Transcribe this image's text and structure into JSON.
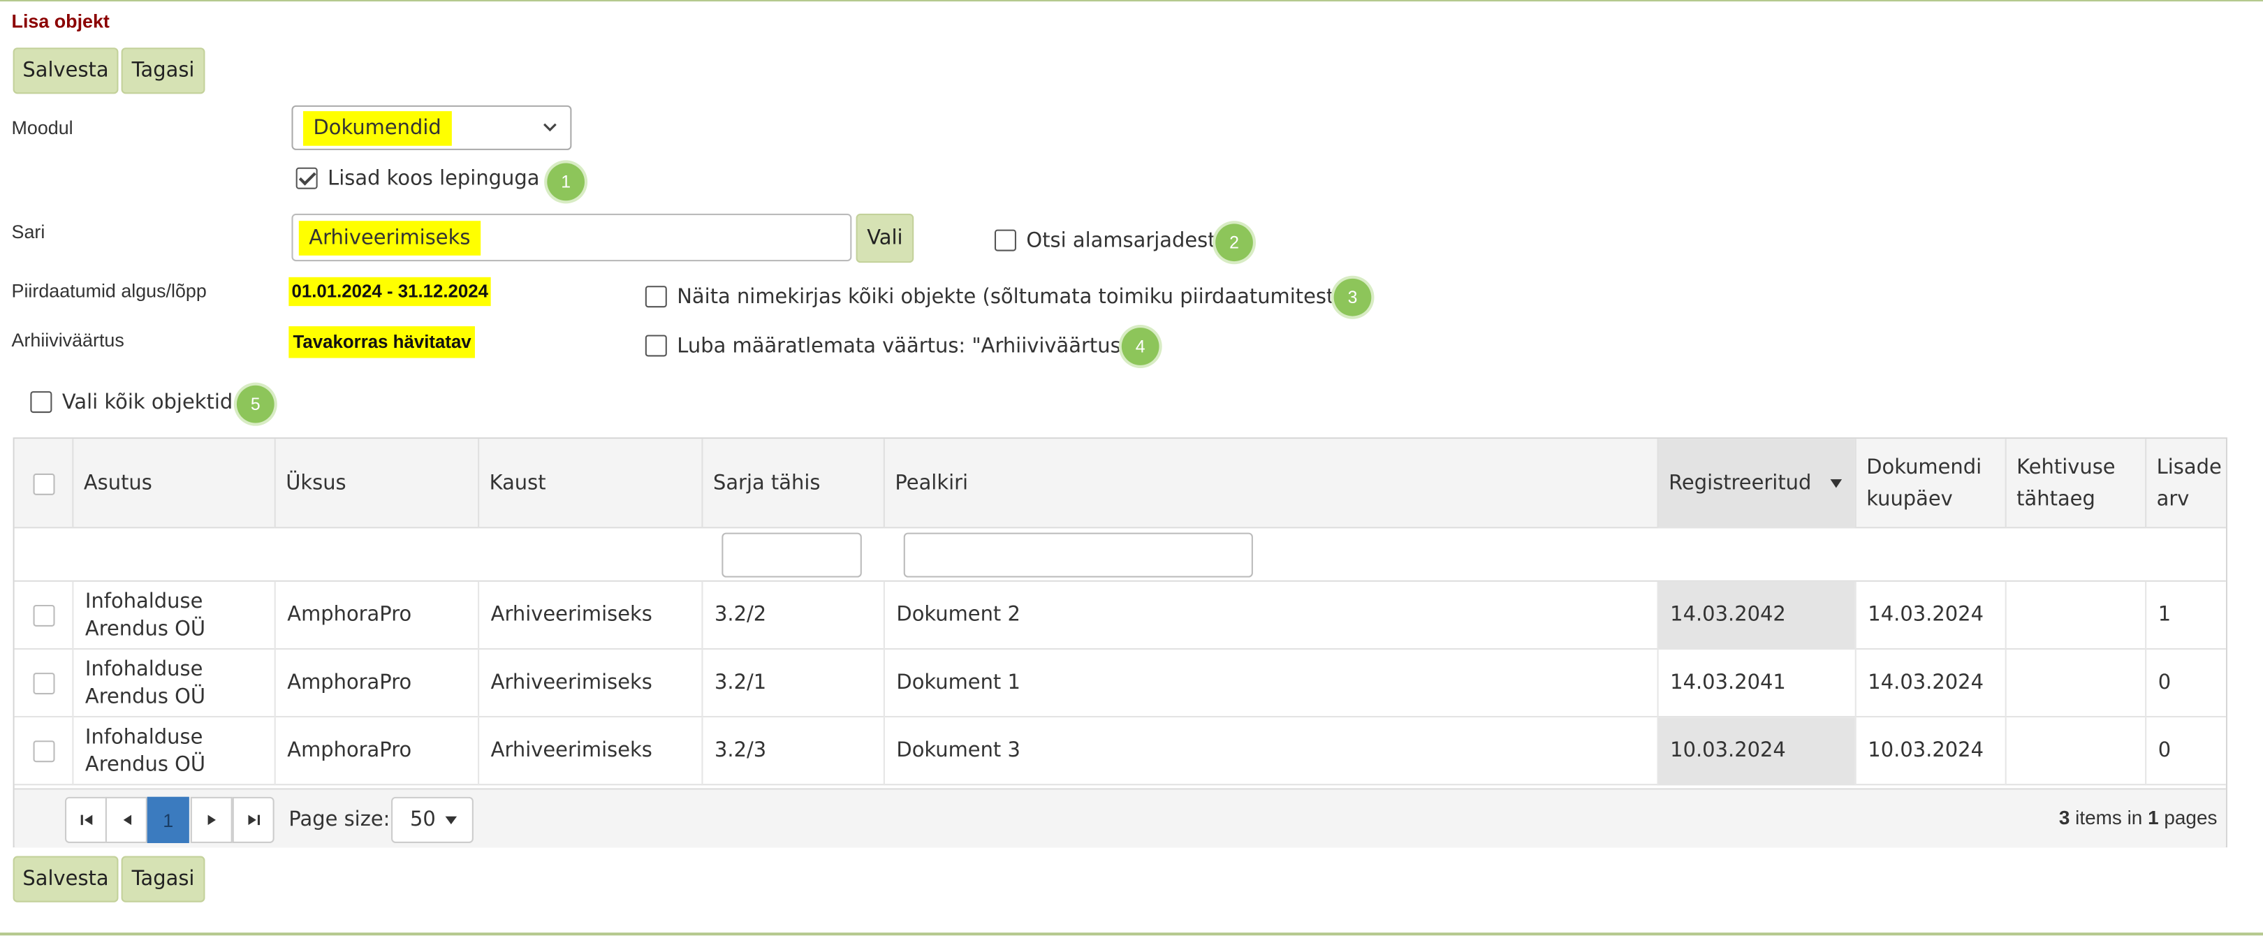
{
  "page": {
    "title": "Lisa objekt"
  },
  "toolbar": {
    "save_label": "Salvesta",
    "back_label": "Tagasi"
  },
  "form": {
    "module_label": "Moodul",
    "module_value": "Dokumendid",
    "contract_checkbox": {
      "label": "Lisad koos lepinguga",
      "checked": true,
      "badge": "1"
    },
    "series_label": "Sari",
    "series_value": "Arhiveerimiseks",
    "choose_label": "Vali",
    "subseries_checkbox": {
      "label": "Otsi alamsarjadest",
      "checked": false,
      "badge": "2"
    },
    "period_label": "Piirdaatumid algus/lõpp",
    "period_value": "01.01.2024 - 31.12.2024",
    "show_all_checkbox": {
      "label": "Näita nimekirjas kõiki objekte (sõltumata toimiku piirdaatumitest)",
      "checked": false,
      "badge": "3"
    },
    "archive_label": "Arhiiviväärtus",
    "archive_value": "Tavakorras hävitatav",
    "allow_undefined_checkbox": {
      "label": "Luba määratlemata väärtus: \"Arhiiviväärtus\"",
      "checked": false,
      "badge": "4"
    },
    "select_all_checkbox": {
      "label": "Vali kõik objektid",
      "checked": false,
      "badge": "5"
    }
  },
  "grid": {
    "columns": [
      {
        "label": "Asutus"
      },
      {
        "label": "Üksus"
      },
      {
        "label": "Kaust"
      },
      {
        "label": "Sarja tähis"
      },
      {
        "label": "Pealkiri"
      },
      {
        "label": "Registreeritud"
      },
      {
        "label": "Dokumendi kuupäev"
      },
      {
        "label": "Kehtivuse tähtaeg"
      },
      {
        "label": "Lisade arv"
      }
    ],
    "rows": [
      {
        "asutus": "Infohalduse Arendus OÜ",
        "yksus": "AmphoraPro",
        "kaust": "Arhiveerimiseks",
        "tahis": "3.2/2",
        "pealkiri": "Dokument 2",
        "registreeritud": "14.03.2042",
        "kuupaev": "14.03.2024",
        "tahtaeg": "",
        "lisad": "1"
      },
      {
        "asutus": "Infohalduse Arendus OÜ",
        "yksus": "AmphoraPro",
        "kaust": "Arhiveerimiseks",
        "tahis": "3.2/1",
        "pealkiri": "Dokument 1",
        "registreeritud": "14.03.2041",
        "kuupaev": "14.03.2024",
        "tahtaeg": "",
        "lisad": "0"
      },
      {
        "asutus": "Infohalduse Arendus OÜ",
        "yksus": "AmphoraPro",
        "kaust": "Arhiveerimiseks",
        "tahis": "3.2/3",
        "pealkiri": "Dokument 3",
        "registreeritud": "10.03.2024",
        "kuupaev": "10.03.2024",
        "tahtaeg": "",
        "lisad": "0"
      }
    ],
    "pager": {
      "current_page": "1",
      "page_size_label": "Page size:",
      "page_size_value": "50",
      "items_count": "3",
      "items_text": "items in",
      "pages_count": "1",
      "pages_text": "pages"
    }
  },
  "colors": {
    "accent": "#d6e2b4",
    "badge": "#8dc55a",
    "highlight": "#ffff00",
    "title": "#8b0000",
    "active_page": "#3b7bbf"
  }
}
